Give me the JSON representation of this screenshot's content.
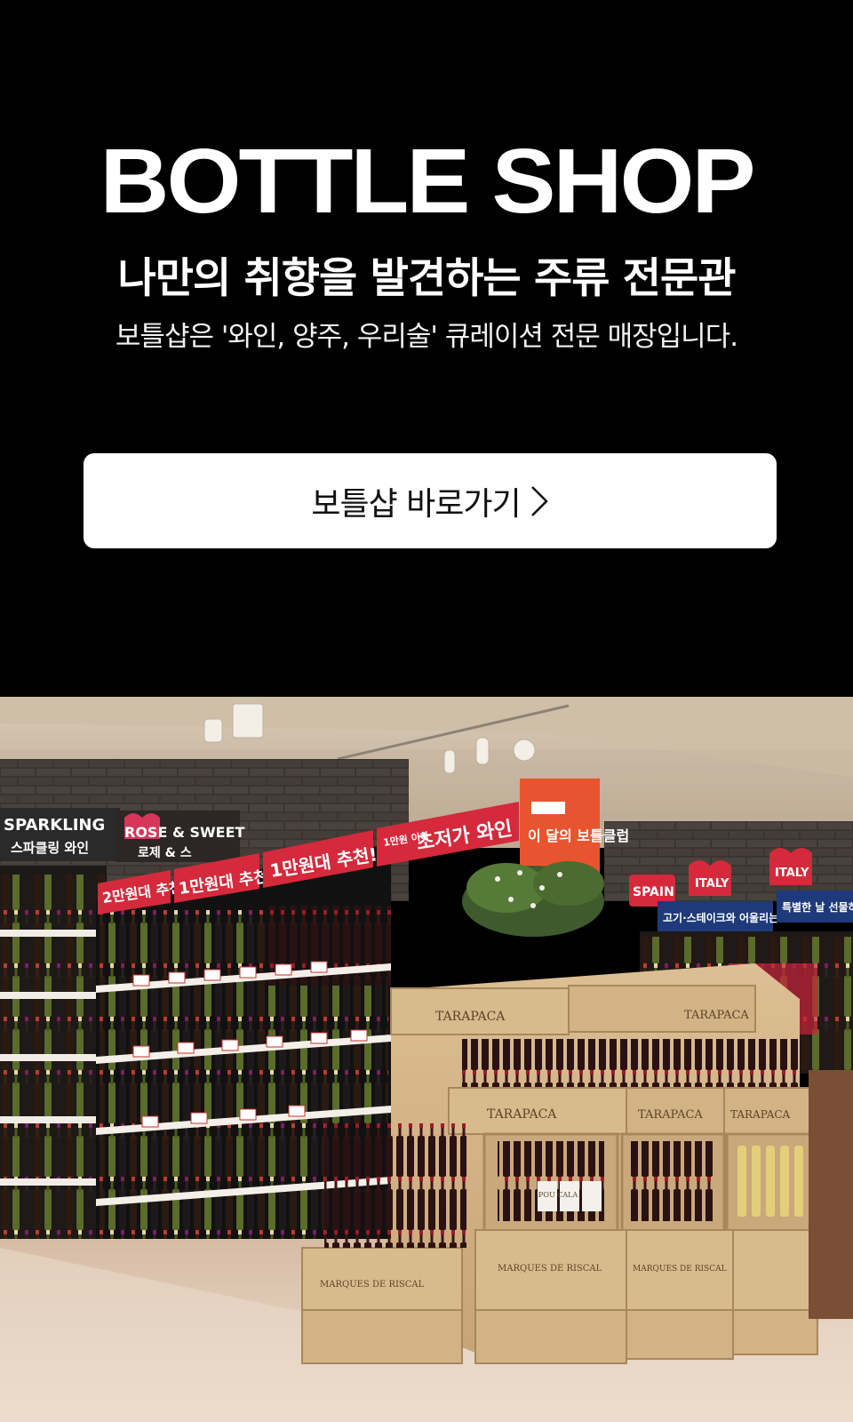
{
  "hero": {
    "title": "BOTTLE SHOP",
    "headline": "나만의 취향을 발견하는 주류 전문관",
    "description": "보틀샵은 '와인, 양주, 우리술' 큐레이션 전문 매장입니다.",
    "cta_label": "보틀샵 바로가기",
    "cta_icon": "chevron-right-icon"
  },
  "photo": {
    "signs": {
      "sparkling_en": "SPARKLING",
      "sparkling_ko": "스파클링 와인",
      "rose": "ROSE & SWEET",
      "rose_ko": "로제 & 스",
      "under20k": "2만원대 추천!",
      "under10k_a": "1만원대 추천!",
      "under10k_b": "1만원대 추천!",
      "value_small": "1만원 이하",
      "value_wine": "초저가 와인",
      "monthly": "이 달의 보틀클럽",
      "bottle_club": "보틀클럽",
      "spain": "SPAIN",
      "italy_a": "ITALY",
      "italy_b": "ITALY",
      "meat": "고기·스테이크와 어울리는",
      "gift": "특별한 날 선물하",
      "tarapaca": "TARAPACA",
      "riscal": "MARQUES DE RISCAL",
      "poul": "POU CALA"
    }
  }
}
